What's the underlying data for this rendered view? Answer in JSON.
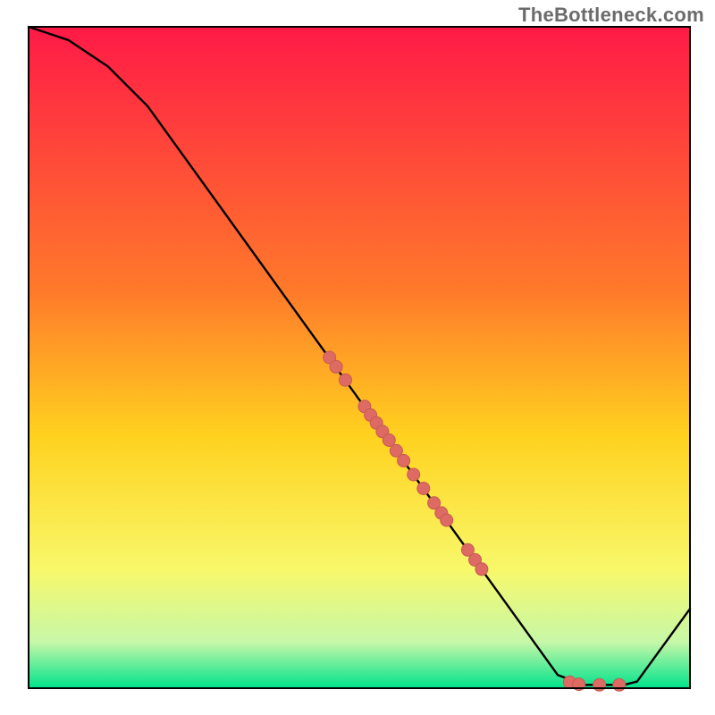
{
  "watermark": "TheBottleneck.com",
  "colors": {
    "gradient_top": "#ff1a47",
    "gradient_mid1": "#ff7a2a",
    "gradient_mid2": "#ffd21f",
    "gradient_mid3": "#f8f86a",
    "gradient_mid4": "#c7f7a8",
    "gradient_bottom": "#00e38c",
    "line": "#000000",
    "dot_fill": "#dd6b63",
    "dot_stroke": "#c75a52",
    "frame": "#000000",
    "background": "#ffffff"
  },
  "chart_data": {
    "type": "line",
    "title": "",
    "xlabel": "",
    "ylabel": "",
    "xlim": [
      0,
      100
    ],
    "ylim": [
      0,
      100
    ],
    "grid": false,
    "legend": false,
    "curve": [
      {
        "x": 0,
        "y": 100
      },
      {
        "x": 6,
        "y": 98
      },
      {
        "x": 12,
        "y": 94
      },
      {
        "x": 18,
        "y": 88
      },
      {
        "x": 80,
        "y": 2
      },
      {
        "x": 84,
        "y": 0.5
      },
      {
        "x": 90,
        "y": 0.5
      },
      {
        "x": 92,
        "y": 1
      },
      {
        "x": 100,
        "y": 12
      }
    ],
    "series": [
      {
        "name": "markers",
        "points": [
          {
            "x": 45.5,
            "y": 50.0
          },
          {
            "x": 46.5,
            "y": 48.6
          },
          {
            "x": 47.9,
            "y": 46.6
          },
          {
            "x": 50.8,
            "y": 42.6
          },
          {
            "x": 51.7,
            "y": 41.3
          },
          {
            "x": 52.6,
            "y": 40.1
          },
          {
            "x": 53.5,
            "y": 38.8
          },
          {
            "x": 54.5,
            "y": 37.5
          },
          {
            "x": 55.6,
            "y": 35.9
          },
          {
            "x": 56.7,
            "y": 34.4
          },
          {
            "x": 58.2,
            "y": 32.3
          },
          {
            "x": 59.7,
            "y": 30.2
          },
          {
            "x": 61.3,
            "y": 28.0
          },
          {
            "x": 62.4,
            "y": 26.5
          },
          {
            "x": 63.2,
            "y": 25.4
          },
          {
            "x": 66.4,
            "y": 20.9
          },
          {
            "x": 67.5,
            "y": 19.4
          },
          {
            "x": 68.5,
            "y": 18.0
          },
          {
            "x": 81.8,
            "y": 0.9
          },
          {
            "x": 83.2,
            "y": 0.6
          },
          {
            "x": 86.3,
            "y": 0.5
          },
          {
            "x": 89.3,
            "y": 0.5
          }
        ]
      }
    ]
  }
}
